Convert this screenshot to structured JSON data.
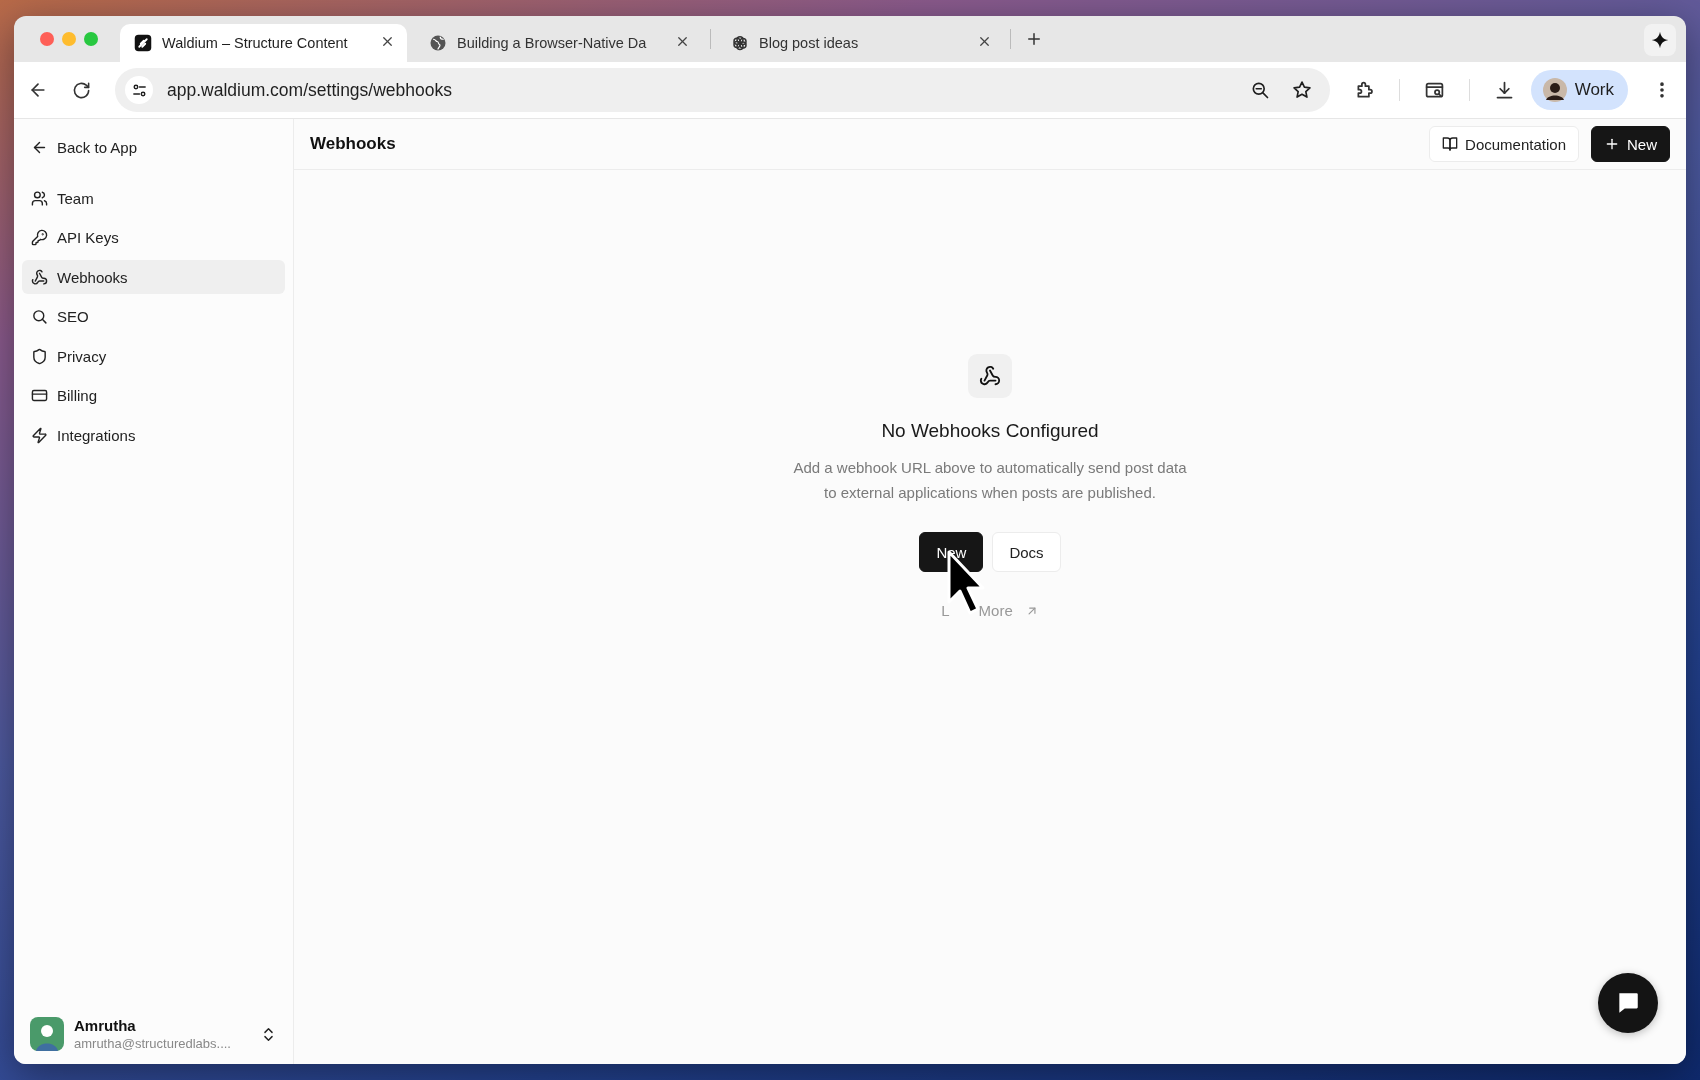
{
  "tabs": [
    {
      "title": "Waldium – Structure Content",
      "selected": true
    },
    {
      "title": "Building a Browser-Native Da",
      "selected": false
    },
    {
      "title": "Blog post ideas",
      "selected": false
    }
  ],
  "address_bar": {
    "url": "app.waldium.com/settings/webhooks"
  },
  "profile": {
    "label": "Work"
  },
  "sidebar": {
    "back_link": "Back to App",
    "items": [
      {
        "label": "Team",
        "selected": false
      },
      {
        "label": "API Keys",
        "selected": false
      },
      {
        "label": "Webhooks",
        "selected": true
      },
      {
        "label": "SEO",
        "selected": false
      },
      {
        "label": "Privacy",
        "selected": false
      },
      {
        "label": "Billing",
        "selected": false
      },
      {
        "label": "Integrations",
        "selected": false
      }
    ],
    "user": {
      "name": "Amrutha",
      "email": "amrutha@structuredlabs...."
    }
  },
  "header": {
    "title": "Webhooks",
    "buttons": [
      {
        "label": "Documentation",
        "kind": "secondary"
      },
      {
        "label": "New",
        "kind": "primary"
      }
    ]
  },
  "empty_state": {
    "title": "No Webhooks Configured",
    "description": "Add a webhook URL above to automatically send post data to external applications when posts are published.",
    "buttons": [
      {
        "label": "New",
        "kind": "primary"
      },
      {
        "label": "Docs",
        "kind": "secondary"
      }
    ],
    "link_parts": [
      "L",
      "More"
    ]
  }
}
